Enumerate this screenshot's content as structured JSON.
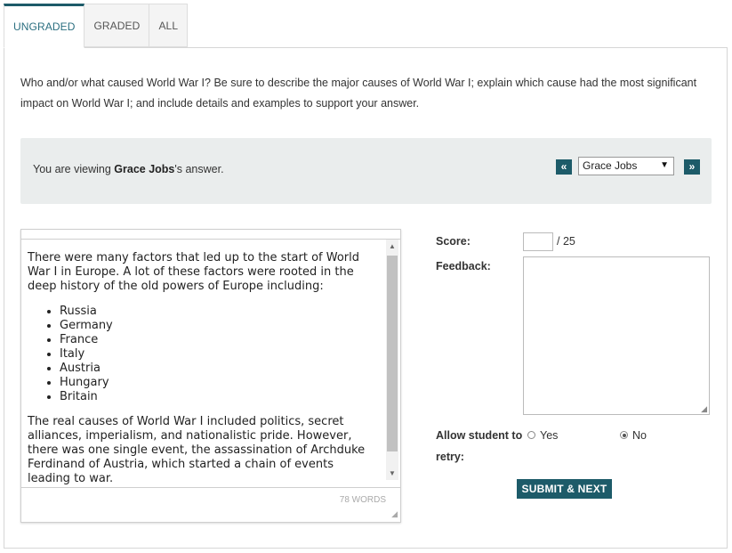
{
  "tabs": [
    {
      "label": "UNGRADED",
      "active": true
    },
    {
      "label": "GRADED",
      "active": false
    },
    {
      "label": "ALL",
      "active": false
    }
  ],
  "question": "Who and/or what caused World War I? Be sure to describe the major causes of World War I; explain which cause had the most significant impact on World War I; and include details and examples to support your answer.",
  "viewing": {
    "prefix": "You are viewing ",
    "student_name": "Grace Jobs",
    "suffix": "'s answer.",
    "prev_label": "«",
    "next_label": "»",
    "selected_student": "Grace Jobs"
  },
  "answer": {
    "intro": "There were many factors that led up to the start of World War I in Europe. A lot of these factors were rooted in the deep history of the old powers of Europe including:",
    "powers": [
      "Russia",
      "Germany",
      "France",
      "Italy",
      "Austria",
      "Hungary",
      "Britain"
    ],
    "causes": "The real causes of World War I included politics, secret alliances, imperialism, and nationalistic pride. However, there was one single event, the assassination of Archduke Ferdinand of Austria, which started a chain of events leading to war.",
    "word_count": "78 WORDS"
  },
  "grading": {
    "score_label": "Score:",
    "score_value": "",
    "score_total": "/ 25",
    "feedback_label": "Feedback:",
    "retry_label_line1": "Allow student to",
    "retry_label_line2": "retry:",
    "yes_label": "Yes",
    "no_label": "No",
    "retry_selected": "No",
    "submit_label": "SUBMIT & NEXT"
  },
  "colors": {
    "accent": "#1d5b69",
    "tab_active_text": "#2b6f80",
    "viewing_bar_bg": "#eaeded"
  }
}
